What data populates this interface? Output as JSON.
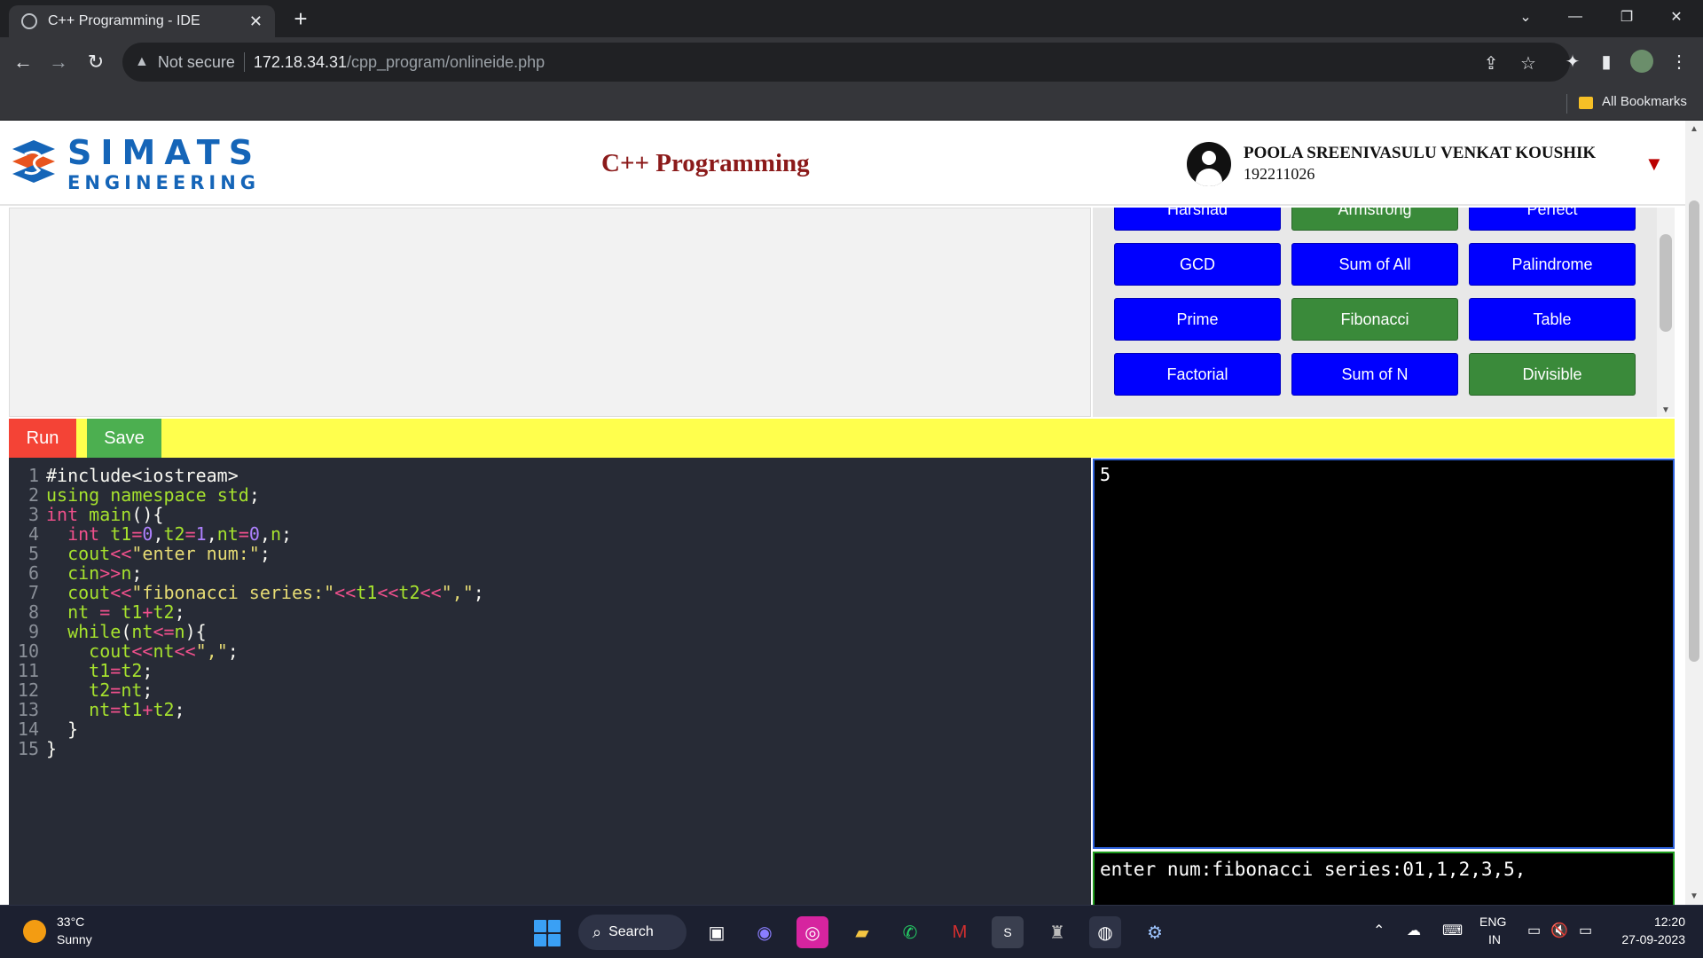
{
  "browser": {
    "tab_title": "C++ Programming - IDE",
    "address_warning": "Not secure",
    "address_host": "172.18.34.31",
    "address_path": "/cpp_program/onlineide.php",
    "bookmarks_label": "All Bookmarks"
  },
  "header": {
    "logo_top": "SIMATS",
    "logo_bottom": "ENGINEERING",
    "page_title": "C++ Programming",
    "user_name": "POOLA SREENIVASULU VENKAT KOUSHIK",
    "user_id": "192211026"
  },
  "program_buttons": [
    {
      "label": "Harshad",
      "color": "#0000ff"
    },
    {
      "label": "Armstrong",
      "color": "#3a8a3a"
    },
    {
      "label": "Perfect",
      "color": "#0000ff"
    },
    {
      "label": "GCD",
      "color": "#0000ff"
    },
    {
      "label": "Sum of All",
      "color": "#0000ff"
    },
    {
      "label": "Palindrome",
      "color": "#0000ff"
    },
    {
      "label": "Prime",
      "color": "#0000ff"
    },
    {
      "label": "Fibonacci",
      "color": "#3a8a3a"
    },
    {
      "label": "Table",
      "color": "#0000ff"
    },
    {
      "label": "Factorial",
      "color": "#0000ff"
    },
    {
      "label": "Sum of N",
      "color": "#0000ff"
    },
    {
      "label": "Divisible",
      "color": "#3a8a3a"
    }
  ],
  "actions": {
    "run_label": "Run",
    "save_label": "Save"
  },
  "code_lines": [
    {
      "n": "1",
      "text": "#include<iostream>"
    },
    {
      "n": "2",
      "text": "using namespace std;"
    },
    {
      "n": "3",
      "text": "int main(){"
    },
    {
      "n": "4",
      "text": "  int t1=0,t2=1,nt=0,n;"
    },
    {
      "n": "5",
      "text": "  cout<<\"enter num:\";"
    },
    {
      "n": "6",
      "text": "  cin>>n;"
    },
    {
      "n": "7",
      "text": "  cout<<\"fibonacci series:\"<<t1<<t2<<\",\";"
    },
    {
      "n": "8",
      "text": "  nt = t1+t2;"
    },
    {
      "n": "9",
      "text": "  while(nt<=n){"
    },
    {
      "n": "10",
      "text": "    cout<<nt<<\",\";"
    },
    {
      "n": "11",
      "text": "    t1=t2;"
    },
    {
      "n": "12",
      "text": "    t2=nt;"
    },
    {
      "n": "13",
      "text": "    nt=t1+t2;"
    },
    {
      "n": "14",
      "text": "  }"
    },
    {
      "n": "15",
      "text": "}"
    }
  ],
  "stdin_value": "5",
  "stdout_value": "enter num:fibonacci series:01,1,2,3,5,",
  "taskbar": {
    "temperature": "33°C",
    "condition": "Sunny",
    "search_label": "Search",
    "lang_top": "ENG",
    "lang_bottom": "IN",
    "time": "12:20",
    "date": "27-09-2023"
  },
  "colors": {
    "run": "#f44336",
    "save": "#4caf50",
    "action_bar": "#ffff4d",
    "title": "#8b1a1a",
    "brand": "#1565b8"
  }
}
